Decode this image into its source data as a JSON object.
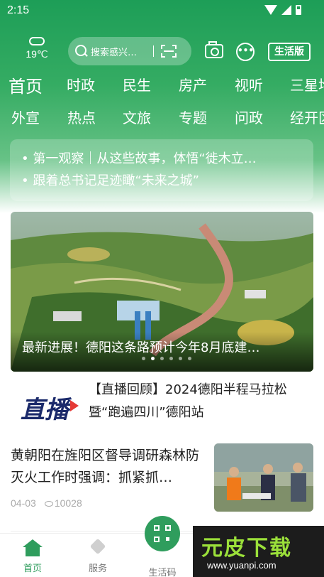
{
  "status": {
    "time": "2:15"
  },
  "weather": {
    "temp": "19℃",
    "icon": "cloud-icon"
  },
  "search": {
    "placeholder": "搜索感兴…",
    "scan_icon": "scan-icon"
  },
  "header": {
    "life_label": "生活版",
    "camera_icon": "camera-icon",
    "chat_icon": "chat-icon",
    "chat_glyph": "•••"
  },
  "nav_row1": [
    {
      "label": "首页",
      "active": true
    },
    {
      "label": "时政"
    },
    {
      "label": "民生"
    },
    {
      "label": "房产"
    },
    {
      "label": "视听"
    },
    {
      "label": "三星堆"
    }
  ],
  "nav_row2": [
    {
      "label": "外宣"
    },
    {
      "label": "热点"
    },
    {
      "label": "文旅"
    },
    {
      "label": "专题"
    },
    {
      "label": "问政"
    },
    {
      "label": "经开区"
    }
  ],
  "hotbox": {
    "items": [
      "• 第一观察｜从这些故事，体悟“徙木立…",
      "• 跟着总书记足迹瞰“未来之城”"
    ]
  },
  "banner": {
    "caption": "最新进展！德阳这条路预计今年8月底建…",
    "dot_count": 6,
    "active_dot": 1
  },
  "live": {
    "logo_text": "直播",
    "title": "【直播回顾】2024德阳半程马拉松暨“跑遍四川”德阳站"
  },
  "news": {
    "title": "黄朝阳在旌阳区督导调研森林防灭火工作时强调：抓紧抓…",
    "date": "04-03",
    "views": "10028"
  },
  "tabbar": {
    "home": "首页",
    "service": "服务",
    "code": "生活码"
  },
  "watermark": {
    "big": "元皮下载",
    "url": "www.yuanpi.com"
  },
  "colors": {
    "brand_green": "#2f9d5d",
    "header_green": "#1d9e57"
  }
}
